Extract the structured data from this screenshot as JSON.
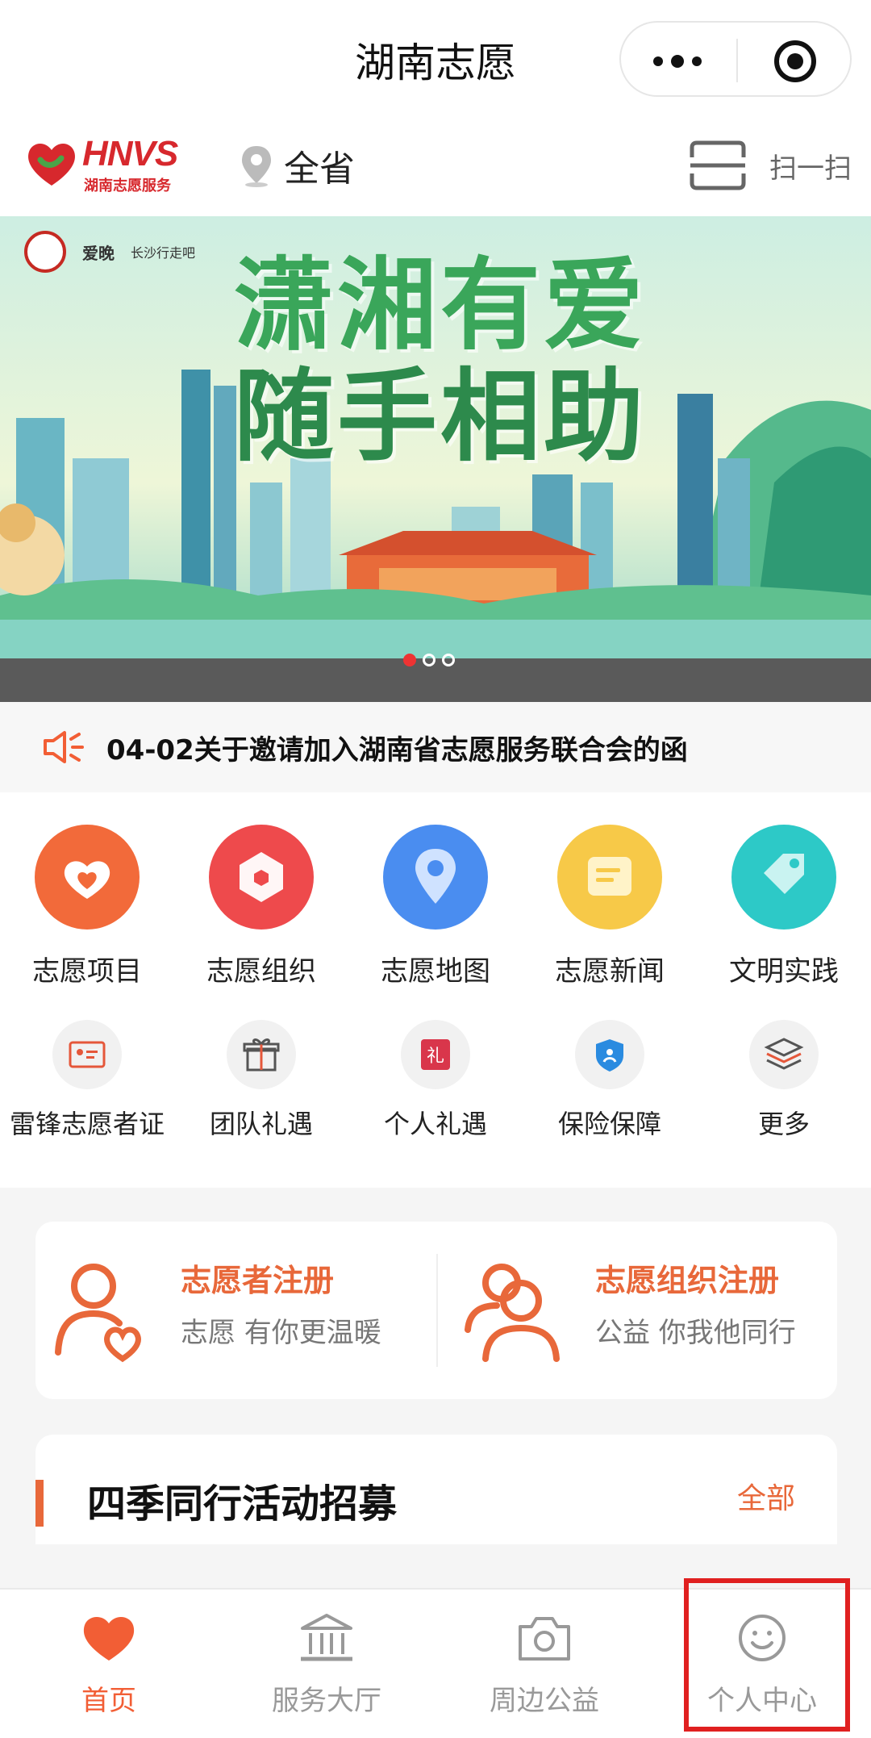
{
  "window": {
    "title": "湖南志愿"
  },
  "header": {
    "brand": "HNVS",
    "brand_sub": "湖南志愿服务",
    "location": "全省",
    "scan_label": "扫一扫"
  },
  "banner": {
    "slogan_line1": "潇湘有爱",
    "slogan_line2": "随手相助",
    "partner2": "爱晚",
    "partner3": "长沙行走吧",
    "page_count": 3,
    "active_page": 1
  },
  "notice": {
    "text": "04-02关于邀请加入湖南省志愿服务联合会的函"
  },
  "menu": {
    "primary": [
      {
        "label": "志愿项目",
        "icon": "heart-icon",
        "color": "#f26a3a"
      },
      {
        "label": "志愿组织",
        "icon": "hexagon-icon",
        "color": "#ee4a4c"
      },
      {
        "label": "志愿地图",
        "icon": "map-pin-icon",
        "color": "#4a8df0"
      },
      {
        "label": "志愿新闻",
        "icon": "news-icon",
        "color": "#f7c948"
      },
      {
        "label": "文明实践",
        "icon": "tag-icon",
        "color": "#2dc9c7"
      }
    ],
    "secondary": [
      {
        "label": "雷锋志愿者证",
        "icon": "id-card-icon"
      },
      {
        "label": "团队礼遇",
        "icon": "gift-icon"
      },
      {
        "label": "个人礼遇",
        "icon": "li-badge-icon"
      },
      {
        "label": "保险保障",
        "icon": "shield-icon"
      },
      {
        "label": "更多",
        "icon": "layers-icon"
      }
    ]
  },
  "register": {
    "volunteer": {
      "title": "志愿者注册",
      "subtitle": "志愿 有你更温暖"
    },
    "organization": {
      "title": "志愿组织注册",
      "subtitle": "公益 你我他同行"
    }
  },
  "section": {
    "title": "四季同行活动招募",
    "more": "全部"
  },
  "tabbar": {
    "tabs": [
      {
        "label": "首页",
        "icon": "heart-icon",
        "active": true
      },
      {
        "label": "服务大厅",
        "icon": "building-icon",
        "active": false
      },
      {
        "label": "周边公益",
        "icon": "camera-icon",
        "active": false
      },
      {
        "label": "个人中心",
        "icon": "smile-icon",
        "active": false
      }
    ]
  },
  "colors": {
    "accent": "#f25e35",
    "highlight": "#e02020"
  }
}
